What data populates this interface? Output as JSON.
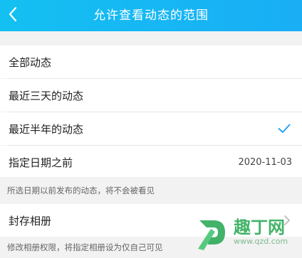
{
  "header": {
    "title": "允许查看动态的范围",
    "back_icon": "chevron-left-icon"
  },
  "options": [
    {
      "label": "全部动态",
      "selected": false
    },
    {
      "label": "最近三天的动态",
      "selected": false
    },
    {
      "label": "最近半年的动态",
      "selected": true
    },
    {
      "label": "指定日期之前",
      "value": "2020-11-03",
      "selected": false
    }
  ],
  "date_note": "所选日期以前发布的动态，将不会被看见",
  "archive": {
    "label": "封存相册",
    "icon": "chevron-right-icon"
  },
  "archive_note": "修改相册权限，将指定相册设为仅自己可见",
  "watermark": {
    "title": "趣丁网",
    "url": "www.qzd.com"
  },
  "colors": {
    "header": "#19aef5",
    "check": "#2aa3f0",
    "watermark": "#22a64f"
  }
}
